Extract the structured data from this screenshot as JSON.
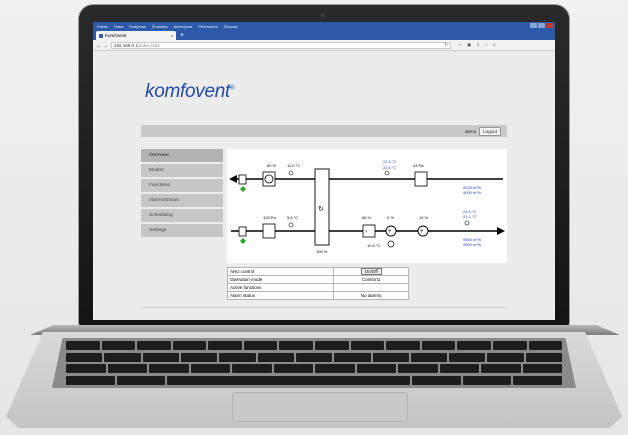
{
  "browser": {
    "menu": [
      "Failas",
      "Taisa",
      "Rodymas",
      "Žurnalas",
      "Adresynas",
      "Priemonės",
      "Žinynas"
    ],
    "tab_title": "Komfovent",
    "tab_close": "×",
    "new_tab": "+",
    "url_host": "192.168.0.1",
    "url_path": "/index.html",
    "reload": "↻",
    "back": "←",
    "forward": "→"
  },
  "page": {
    "logo": "komfovent",
    "logo_mark": "®",
    "user": "demo",
    "logout": "Logout"
  },
  "sidebar": {
    "items": [
      {
        "label": "Overview",
        "active": true
      },
      {
        "label": "Modes"
      },
      {
        "label": "Functions"
      },
      {
        "label": "Alarms/Status"
      },
      {
        "label": "Scheduling"
      },
      {
        "label": "Settings"
      }
    ]
  },
  "diagram": {
    "labels": {
      "top_fan_pct": "60 %",
      "top_temp": "11.0 °C",
      "exhaust_temp_1": "22.5 °C",
      "exhaust_temp_2": "22.6 °C",
      "top_pressure": "43 Pa",
      "top_airflow_1": "9025 m³/h",
      "top_airflow_2": "9000 m³/h",
      "supply_pressure": "103 Pa",
      "supply_temp_in": "5.6 °C",
      "rotor_pct": "100 %",
      "supply_fan_pct": "66 %",
      "heater_pct": "0 %",
      "cooler_pct": "10 %",
      "water_temp": "10.5 °C",
      "supply_temp_1": "21.5 °C",
      "supply_temp_2": "21.1 °C",
      "supply_airflow_1": "9600 m³/h",
      "supply_airflow_2": "9600 m³/h"
    },
    "colors": {
      "blue": "#1d3ec9",
      "green": "#2aa52a"
    }
  },
  "status": {
    "rows": [
      {
        "label": "AHU control",
        "value": "On/Off"
      },
      {
        "label": "Operation mode",
        "value": "Comfort1"
      },
      {
        "label": "Active functions",
        "value": ""
      },
      {
        "label": "Alarm status",
        "value": "No alarms"
      }
    ]
  }
}
